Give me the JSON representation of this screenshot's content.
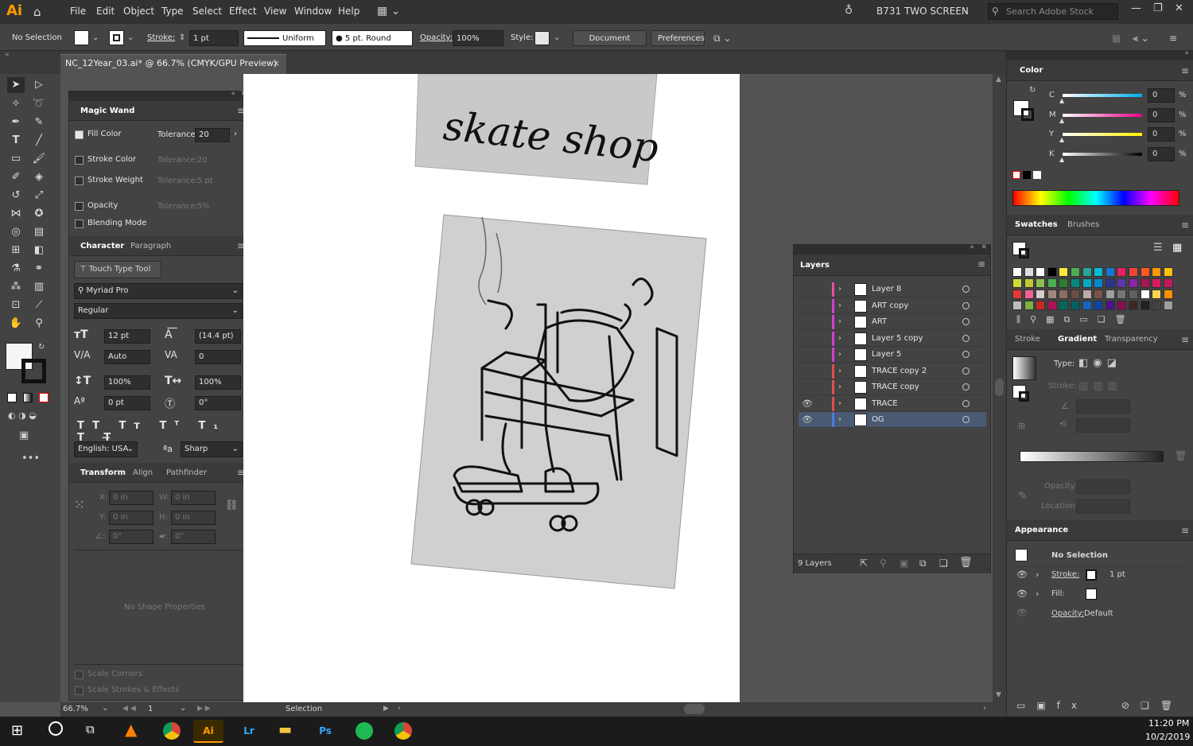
{
  "app": {
    "logo": "Ai",
    "workspace": "B731 TWO SCREEN",
    "search_placeholder": "Search Adobe Stock"
  },
  "menu": [
    "File",
    "Edit",
    "Object",
    "Type",
    "Select",
    "Effect",
    "View",
    "Window",
    "Help"
  ],
  "control": {
    "selection": "No Selection",
    "stroke_label": "Stroke:",
    "stroke_value": "1 pt",
    "profile": "Uniform",
    "brush": "5 pt. Round",
    "opacity_label": "Opacity:",
    "opacity_value": "100%",
    "style_label": "Style:",
    "doc_setup": "Document Setup",
    "preferences": "Preferences"
  },
  "document": {
    "tab_title": "NC_12Year_03.ai* @ 66.7% (CMYK/GPU Preview)",
    "close": "×"
  },
  "magic_wand": {
    "title": "Magic Wand",
    "rows": [
      {
        "label": "Fill Color",
        "checked": true,
        "tol_label": "Tolerance:",
        "tol": "20"
      },
      {
        "label": "Stroke Color",
        "checked": false,
        "tol_label": "Tolerance:",
        "tol": "20"
      },
      {
        "label": "Stroke Weight",
        "checked": false,
        "tol_label": "Tolerance:",
        "tol": "5 pt"
      },
      {
        "label": "Opacity",
        "checked": false,
        "tol_label": "Tolerance:",
        "tol": "5%"
      },
      {
        "label": "Blending Mode",
        "checked": false
      }
    ]
  },
  "character": {
    "tabs": [
      "Character",
      "Paragraph"
    ],
    "touch_type": "Touch Type Tool",
    "font": "Myriad Pro",
    "style": "Regular",
    "size": "12 pt",
    "leading": "(14.4 pt)",
    "kerning": "Auto",
    "tracking": "0",
    "vscale": "100%",
    "hscale": "100%",
    "baseline": "0 pt",
    "rotate": "0°",
    "language": "English: USA",
    "aa": "Sharp"
  },
  "transform": {
    "tabs": [
      "Transform",
      "Align",
      "Pathfinder"
    ],
    "x": "0 in",
    "y": "0 in",
    "w": "0 in",
    "h": "0 in",
    "angle": "0°",
    "shear": "0°",
    "no_shape": "No Shape Properties",
    "scale_corners": "Scale Corners",
    "scale_strokes": "Scale Strokes & Effects"
  },
  "status": {
    "zoom": "66.7%",
    "page": "1",
    "tool": "Selection"
  },
  "color_panel": {
    "title": "Color",
    "channels": [
      {
        "name": "C",
        "value": "0"
      },
      {
        "name": "M",
        "value": "0"
      },
      {
        "name": "Y",
        "value": "0"
      },
      {
        "name": "K",
        "value": "0"
      }
    ],
    "pct": "%"
  },
  "swatches": {
    "tabs": [
      "Swatches",
      "Brushes"
    ]
  },
  "stroke_grad": {
    "tabs": [
      "Stroke",
      "Gradient",
      "Transparency"
    ],
    "type": "Type:",
    "stroke": "Stroke:",
    "opacity": "Opacity:",
    "location": "Location:"
  },
  "appearance": {
    "title": "Appearance",
    "selection": "No Selection",
    "stroke_label": "Stroke:",
    "stroke_value": "1 pt",
    "fill_label": "Fill:",
    "opacity_label": "Opacity:",
    "opacity_value": "Default"
  },
  "layers": {
    "title": "Layers",
    "count": "9 Layers",
    "items": [
      {
        "name": "Layer 8",
        "color": "#e84fa4",
        "visible": false,
        "selected": false
      },
      {
        "name": "ART copy",
        "color": "#d43fd4",
        "visible": false,
        "selected": false
      },
      {
        "name": "ART",
        "color": "#d43fd4",
        "visible": false,
        "selected": false
      },
      {
        "name": "Layer 5 copy",
        "color": "#d43fd4",
        "visible": false,
        "selected": false
      },
      {
        "name": "Layer 5",
        "color": "#d43fd4",
        "visible": false,
        "selected": false
      },
      {
        "name": "TRACE copy 2",
        "color": "#e05050",
        "visible": false,
        "selected": false
      },
      {
        "name": "TRACE copy",
        "color": "#e05050",
        "visible": false,
        "selected": false
      },
      {
        "name": "TRACE",
        "color": "#e05050",
        "visible": true,
        "selected": false
      },
      {
        "name": "OG",
        "color": "#4a7be0",
        "visible": true,
        "selected": true
      }
    ]
  },
  "artwork": {
    "sign_text": "skate shop"
  },
  "taskbar": {
    "time": "11:20 PM",
    "date": "10/2/2019",
    "apps": [
      "Ai",
      "Lr",
      "Ps"
    ]
  },
  "colors": {
    "ai_orange": "#ff9a00",
    "panel_bg": "#434343",
    "canvas_bg": "#535353",
    "selected_row": "#4a5a72",
    "taskbar": "#1b1b1b"
  }
}
